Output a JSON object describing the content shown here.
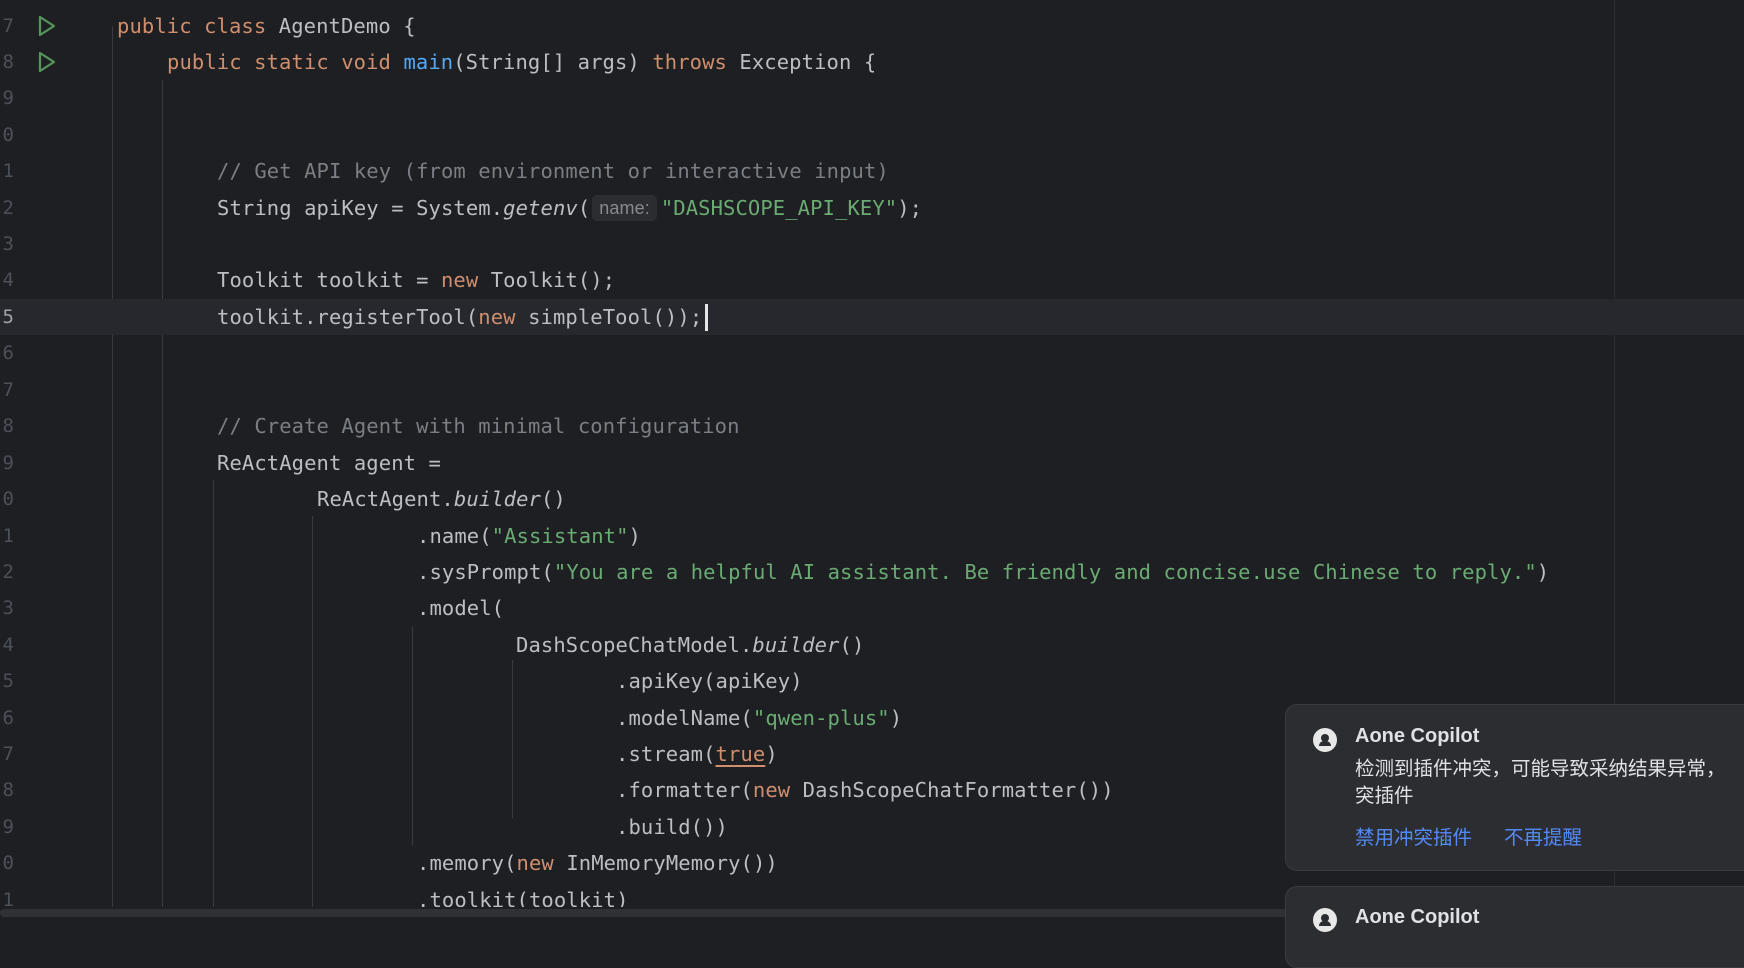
{
  "editor": {
    "line_numbers": [
      "7",
      "8",
      "9",
      "0",
      "1",
      "2",
      "3",
      "4",
      "5",
      "6",
      "7",
      "8",
      "9",
      "0",
      "1",
      "2",
      "3",
      "4",
      "5",
      "6",
      "7",
      "8",
      "9",
      "0",
      "1"
    ],
    "code": {
      "l7": [
        "public",
        "class",
        "AgentDemo {"
      ],
      "l8": [
        "public",
        "static",
        "void",
        "main",
        "(String[] args) ",
        "throws",
        " Exception {"
      ],
      "l11": "// Get API key (from environment or interactive input)",
      "l12": [
        "String apiKey = System.",
        "getenv",
        "(",
        "name:",
        "\"DASHSCOPE_API_KEY\"",
        ");"
      ],
      "l14": [
        "Toolkit toolkit = ",
        "new",
        " Toolkit();"
      ],
      "l15": [
        "toolkit.registerTool(",
        "new",
        " simpleTool());"
      ],
      "l18": "// Create Agent with minimal configuration",
      "l19": "ReActAgent agent =",
      "l20": [
        "ReActAgent.",
        "builder",
        "()"
      ],
      "l21": [
        ".name(",
        "\"Assistant\"",
        ")"
      ],
      "l22": [
        ".sysPrompt(",
        "\"You are a helpful AI assistant. Be friendly and concise.use Chinese to reply.\"",
        ")"
      ],
      "l23": ".model(",
      "l24": [
        "DashScopeChatModel.",
        "builder",
        "()"
      ],
      "l25": ".apiKey(apiKey)",
      "l26": [
        ".modelName(",
        "\"qwen-plus\"",
        ")"
      ],
      "l27": [
        ".stream(",
        "true",
        ")"
      ],
      "l28": [
        ".formatter(",
        "new",
        " DashScopeChatFormatter())"
      ],
      "l29": ".build())",
      "l30": [
        ".memory(",
        "new",
        " InMemoryMemory())"
      ],
      "l31": ".toolkit(toolkit)"
    }
  },
  "notifications": [
    {
      "icon": "copilot-icon",
      "title": "Aone Copilot",
      "message_line1": "检测到插件冲突，可能导致采纳结果异常，",
      "message_line2": "突插件",
      "action_primary": "禁用冲突插件",
      "action_secondary": "不再提醒"
    },
    {
      "icon": "copilot-icon",
      "title": "Aone Copilot"
    }
  ],
  "colors": {
    "background": "#1e1f22",
    "keyword": "#cf8e6d",
    "function": "#56a8f5",
    "string": "#6aab73",
    "comment": "#7a7e85",
    "link": "#548af7"
  }
}
